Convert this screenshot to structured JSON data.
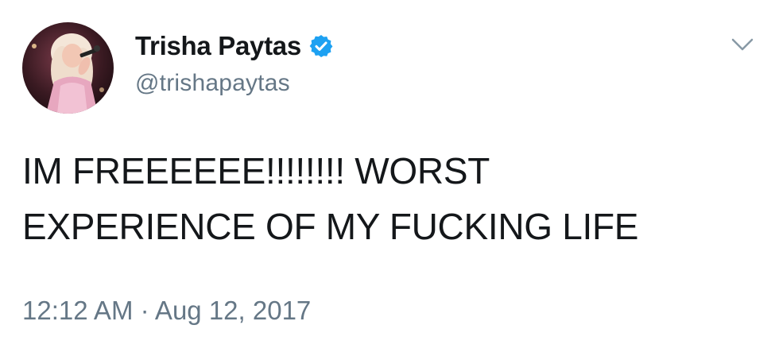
{
  "tweet": {
    "user": {
      "display_name": "Trisha Paytas",
      "handle": "@trishapaytas",
      "verified": true,
      "avatar_icon": "user-avatar-photo"
    },
    "text": "IM FREEEEEE!!!!!!!! WORST\nEXPERIENCE OF MY FUCKING LIFE",
    "timestamp": "12:12 AM · Aug 12, 2017",
    "menu_icon": "chevron-down-icon"
  },
  "colors": {
    "text_primary": "#14171a",
    "text_secondary": "#657786",
    "verified_blue": "#1da1f2",
    "caret": "#8899a6"
  }
}
